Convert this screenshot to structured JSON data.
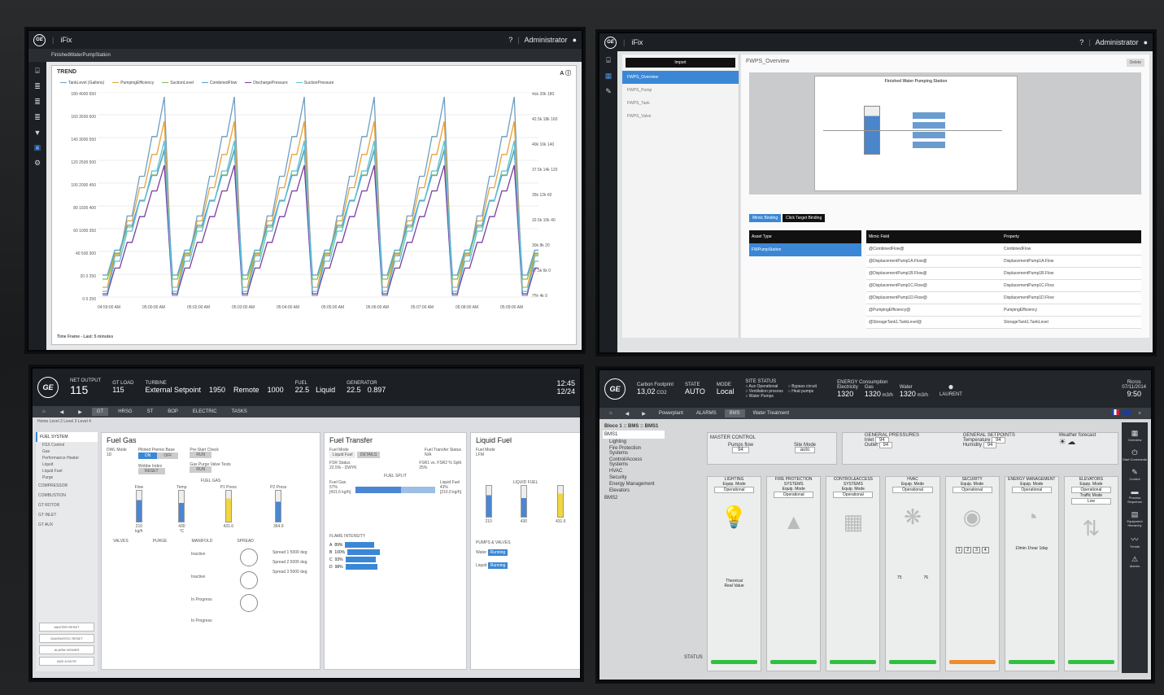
{
  "m1": {
    "app_title": "iFix",
    "user": "Administrator",
    "breadcrumb": "FinishedWaterPumpStation",
    "panel_title": "TREND",
    "legend": [
      "TankLevel (Gallons)",
      "PumpingEfficiency",
      "SuctionLevel",
      "CombinedFlow",
      "DischargePressure",
      "SuctionPressure"
    ],
    "legend_colors": [
      "#6f9fc2",
      "#e6a23c",
      "#7fbf4d",
      "#5a9fd4",
      "#7a3fa0",
      "#59c2d8"
    ],
    "left_ticks": [
      "180 4000 650",
      "160 3500 600",
      "140 3000 550",
      "120 2500 500",
      "100 2000 450",
      "80 1500 400",
      "60 1000 350",
      "40 500 300",
      "20 0 250",
      "0 0 250"
    ],
    "right_ticks": [
      "45k  20k 180",
      "42.5k 18k 160",
      "40k 16k 140",
      "37.5k 14k 120",
      "35k 12k 60",
      "32.5k 10k 40",
      "30k 8k 20",
      "27.5k 6k 0",
      "25k 4k 0"
    ],
    "x_ticks": [
      "04:59:00 AM",
      "05:00:00 AM",
      "05:02:00 AM",
      "05:03:00 AM",
      "05:04:00 AM",
      "05:05:00 AM",
      "05:06:00 AM",
      "05:07:00 AM",
      "05:08:00 AM",
      "05:09:00 AM"
    ],
    "time_frame": "Time Frame - Last: 5 minutes"
  },
  "m2": {
    "app_title": "iFix",
    "user": "Administrator",
    "import_label": "Import",
    "items": [
      "FWPS_Overview",
      "FWPS_Pump",
      "FWPS_Tank",
      "FWPS_Valve"
    ],
    "title": "FWPS_Overview",
    "delete_label": "Delete",
    "mimic_title": "Finished Water Pumping Station",
    "tabs": [
      "Mimic Binding",
      "Click Target Binding"
    ],
    "asset_type_header": "Asset Type",
    "asset_type_value": "FWPumpStation",
    "headers": [
      "Mimic Field",
      "Property"
    ],
    "rows": [
      [
        "@CombinedFlow@",
        "CombinedFlow"
      ],
      [
        "@DisplacementPump1A.Flow@",
        "DisplacementPump1A.Flow"
      ],
      [
        "@DisplacementPump1B.Flow@",
        "DisplacementPump1B.Flow"
      ],
      [
        "@DisplacementPump1C.Flow@",
        "DisplacementPump1C.Flow"
      ],
      [
        "@DisplacementPump1D.Flow@",
        "DisplacementPump1D.Flow"
      ],
      [
        "@PumpingEfficiency@",
        "PumpingEfficiency"
      ],
      [
        "@StorageTank1.TankLevel@",
        "StorageTank1.TankLevel"
      ]
    ]
  },
  "m3": {
    "header": {
      "net_output_label": "NET OUTPUT",
      "net_output": "115",
      "gt_load_label": "GT LOAD",
      "gt_load": "115",
      "turbine_label": "TURBINE",
      "turbine_mode": "External Setpoint",
      "speed": "1950",
      "control": "Remote",
      "thrm": "1000",
      "fuel_label": "FUEL",
      "fuel_val": "22.5",
      "fuel_mode": "Liquid",
      "generator_label": "GENERATOR",
      "gen_load": "22.5",
      "pf": "0.897",
      "time": "12:45",
      "date": "12/24"
    },
    "tabs": [
      "GT",
      "HRSG",
      "ST",
      "BOP",
      "ELECTRIC",
      "TASKS"
    ],
    "breadcrumb": "Home  Level 2  Level 3  Level 4",
    "nav": [
      "FUEL SYSTEM",
      "COMPRESSOR",
      "COMBUSTION",
      "GT ROTOR",
      "GT INLET",
      "GT AUX"
    ],
    "nav_sub": [
      "FSX Control",
      "Gas",
      "Performance Heater",
      "Liquid",
      "Liquid Fuel",
      "Purge"
    ],
    "side_buttons": [
      "MASTER RESET",
      "DIAGNOSTIC RESET",
      "ALARM VIEWER",
      "ADD A NOTE"
    ],
    "fuel_gas": {
      "title": "Fuel Gas",
      "dwl_mode": "DWL Mode",
      "dwl_value": "1D",
      "purge": "Piloted Premix Base",
      "on": "ON",
      "off": "OFF",
      "wobbe": "Wobbe Index",
      "reset": "RESET",
      "prestart": "Pre-Start Check",
      "run": "RUN",
      "gasvalve": "Gas Purge Valve Tests",
      "run2": "RUN",
      "section": "FUEL GAS",
      "flow_label": "Flow",
      "flow": "210",
      "flow_unit": "kg/h",
      "temp_label": "Temp",
      "temp": "430",
      "temp_unit": "°C",
      "p1_label": "P1 Press",
      "p1": "431.6",
      "p2_label": "P2 Press",
      "p2": "364.9",
      "avg": "AVG-AB",
      "valves": "VALVES",
      "purge_lbl": "PURGE",
      "manifold": "MANIFOLD",
      "spread": "SPREAD",
      "inactive": "Inactive",
      "in_progress": "In Progress",
      "spreads": [
        "Spread 1  5000 deg",
        "Spread 2  5000 deg",
        "Spread 3  5000 deg"
      ]
    },
    "fuel_transfer": {
      "title": "Fuel Transfer",
      "fuel_mode": "Fuel Mode",
      "mode_value": "Liquid Fuel",
      "details": "DETAILS",
      "status_label": "Fuel Transfer Status",
      "status": "N/A",
      "fsr": "FSR Status",
      "fsr_value": "22.5% - DWYK",
      "fsr2": "FSR1 vs. FSR2 % Split",
      "fsr2_value": "25%",
      "split": "FUEL SPLIT",
      "gas_label": "Fuel Gas",
      "gas_pct": "57%",
      "gas_val": "[431.6 kg/h]",
      "liq_label": "Liquid Fuel",
      "liq_pct": "43%",
      "liq_val": "[210.0 kg/h]",
      "flame": "FLAME INTENSITY",
      "flames": [
        [
          "A",
          "89%"
        ],
        [
          "B",
          "100%"
        ],
        [
          "C",
          "93%"
        ],
        [
          "D",
          "98%"
        ]
      ]
    },
    "liquid_fuel": {
      "title": "Liquid Fuel",
      "mode": "Fuel Mode",
      "mode_val": "LFM",
      "section": "LIQUID FUEL",
      "flow": "210",
      "temp": "430",
      "press": "431.6",
      "pumps": "PUMPS & VALVES",
      "water": "Water",
      "liquid": "Liquid",
      "running": "Running"
    }
  },
  "m4": {
    "carbon_label": "Carbon Footprint",
    "carbon": "13,02",
    "co2": "CO2",
    "state_label": "STATE",
    "state": "AUTO",
    "mode_label": "MODE",
    "mode": "Local",
    "site_status": "SITE STATUS",
    "site_items": [
      "Aux Operational",
      "Bypass circuit",
      "Ventilation process",
      "Heat pumps",
      "Water Pumps"
    ],
    "energy_label": "ENERGY Consumption",
    "electricity_label": "Electricity",
    "electricity": "1320",
    "gas_label": "Gas",
    "gas": "1320",
    "gas_unit": "m3/h",
    "water_label": "Water",
    "water": "1320",
    "water_unit": "m3/h",
    "user": "LAURENT",
    "site": "Ricros",
    "date": "07/11/2014",
    "time": "9:50",
    "tabs": [
      "Powerplant",
      "ALARMS",
      "BMS",
      "Water Treatment"
    ],
    "tree_root": "Bloco 1 :: BMS :: BMS1",
    "tree": [
      "BMS1",
      "Lighting",
      "Fire Protection Systems",
      "Control/Access Systems",
      "HVAC",
      "Security",
      "Energy Management",
      "Elevators",
      "BMS2"
    ],
    "master_control": "MASTER CONTROL",
    "pumps_flow": "Pumps flow",
    "pumps_val": "94",
    "site_mode": "Site Mode",
    "site_mode_val": "auto",
    "gen_press": "GENERAL PRESSURES",
    "inlet": "Inlet",
    "outlet": "Outlet",
    "inlet_val": "94",
    "outlet_val": "94",
    "gen_set": "GENERAL SETPOINTS",
    "temperature": "Temperature",
    "humidity": "Humidity",
    "temp_val": "94",
    "hum_val": "94",
    "weather": "Weather forecast",
    "systems": [
      "LIGHTING",
      "FIRE PROTECTION SYSTEMS",
      "CONTROL&ACCESS SYSTEMS",
      "HVAC",
      "SECURITY",
      "ENERGY MANAGEMENT",
      "ELEVATORS"
    ],
    "equip_mode": "Equip. Mode",
    "operational": "Operational",
    "traffic_mode": "Traffic Mode",
    "low": "Low",
    "hvac_vals": [
      "75",
      "76"
    ],
    "security_cams": [
      "1",
      "2",
      "3",
      "4"
    ],
    "energy_tabs": [
      "10min",
      "1hour",
      "1day"
    ],
    "theorical": "Theorical",
    "real_value": "Real Value",
    "status_label": "STATUS",
    "right_nav": [
      "Overview",
      "Start Commands",
      "Control",
      "Process Sequence",
      "Equipment Hierarchy",
      "Trends",
      "Alarms"
    ]
  }
}
